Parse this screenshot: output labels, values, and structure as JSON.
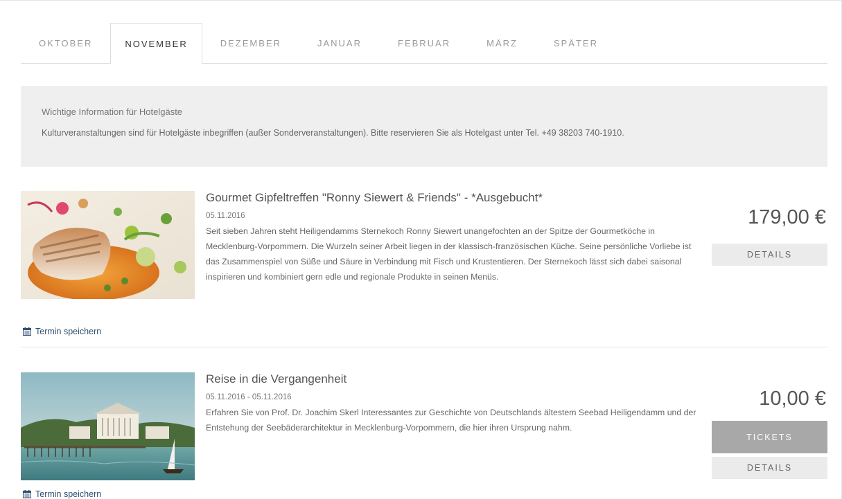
{
  "tabs": [
    {
      "label": "OKTOBER",
      "active": false
    },
    {
      "label": "NOVEMBER",
      "active": true
    },
    {
      "label": "DEZEMBER",
      "active": false
    },
    {
      "label": "JANUAR",
      "active": false
    },
    {
      "label": "FEBRUAR",
      "active": false
    },
    {
      "label": "MÄRZ",
      "active": false
    },
    {
      "label": "SPÄTER",
      "active": false
    }
  ],
  "info": {
    "title": "Wichtige Information für Hotelgäste",
    "text": "Kulturveranstaltungen sind für Hotelgäste inbegriffen (außer Sonderveranstaltungen). Bitte reservieren Sie als Hotelgast unter Tel. +49 38203 740-1910."
  },
  "events": [
    {
      "title": "Gourmet Gipfeltreffen \"Ronny Siewert & Friends\" - *Ausgebucht*",
      "date": "05.11.2016",
      "description": "Seit sieben Jahren steht Heiligendamms Sternekoch Ronny Siewert unangefochten an der Spitze der Gourmetköche in Mecklenburg-Vorpommern. Die Wurzeln seiner Arbeit liegen in der klassisch-französischen Küche. Seine persönliche Vorliebe ist das Zusammenspiel von Süße und Säure in Verbindung mit Fisch und Krustentieren. Der Sternekoch lässt sich dabei saisonal inspirieren und kombiniert gern edle und regionale Produkte in seinen Menüs.",
      "price": "179,00 €",
      "details_label": "DETAILS",
      "save_label": "Termin speichern"
    },
    {
      "title": "Reise in die Vergangenheit",
      "date": "05.11.2016 - 05.11.2016",
      "description": "Erfahren Sie von Prof. Dr. Joachim Skerl Interessantes zur Geschichte von Deutschlands ältestem Seebad Heiligendamm und der Entstehung der Seebäderarchitektur in Mecklenburg-Vorpommern, die hier ihren Ursprung nahm.",
      "price": "10,00 €",
      "tickets_label": "TICKETS",
      "details_label": "DETAILS",
      "save_label": "Termin speichern"
    }
  ],
  "colors": {
    "link": "#2f4f6f",
    "tickets_button": "#a8a8a8",
    "details_button": "#ebebeb",
    "info_background": "#efefef"
  }
}
